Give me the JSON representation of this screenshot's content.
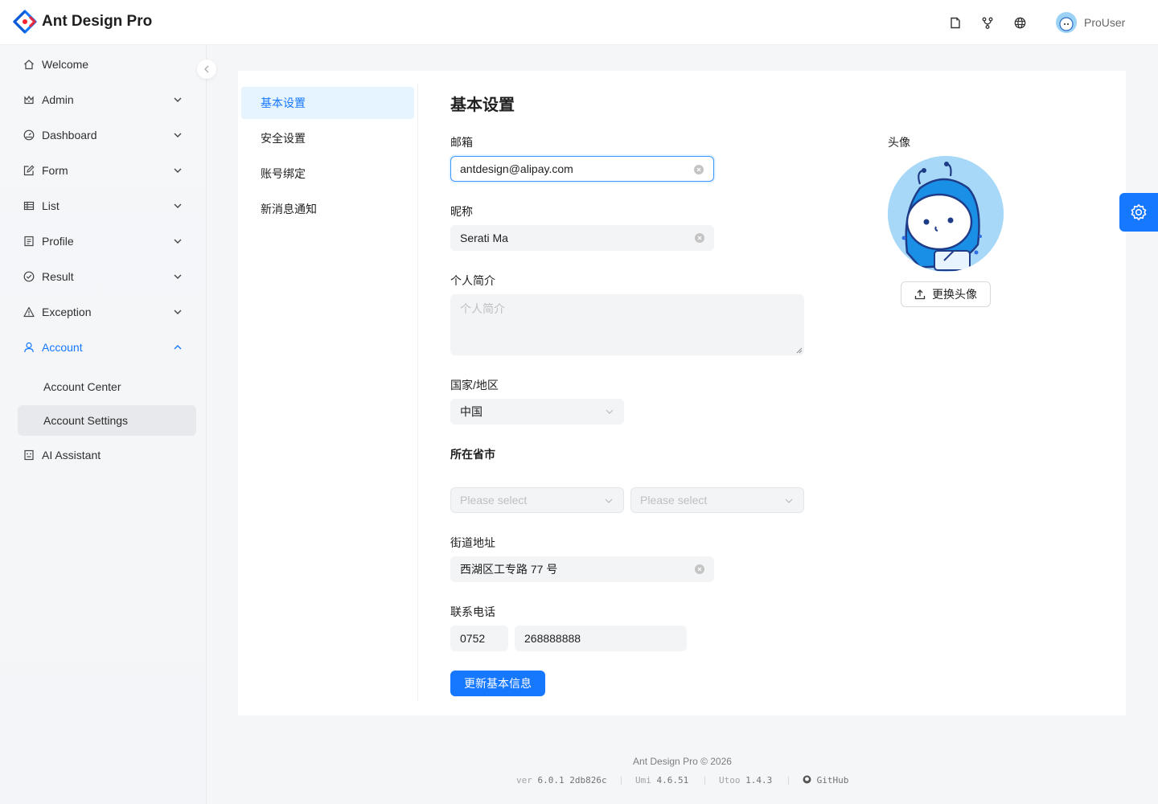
{
  "header": {
    "app_title": "Ant Design Pro",
    "user_name": "ProUser",
    "icons": [
      "docs-icon",
      "branch-icon",
      "language-icon"
    ]
  },
  "sidebar": {
    "items": [
      {
        "label": "Welcome",
        "icon": "home-icon"
      },
      {
        "label": "Admin",
        "icon": "crown-icon"
      },
      {
        "label": "Dashboard",
        "icon": "dashboard-icon"
      },
      {
        "label": "Form",
        "icon": "form-icon"
      },
      {
        "label": "List",
        "icon": "table-icon"
      },
      {
        "label": "Profile",
        "icon": "profile-icon"
      },
      {
        "label": "Result",
        "icon": "check-circle-icon"
      },
      {
        "label": "Exception",
        "icon": "warning-icon"
      },
      {
        "label": "Account",
        "icon": "user-icon"
      },
      {
        "label": "AI Assistant",
        "icon": "robot-icon"
      }
    ],
    "account_sub": [
      "Account Center",
      "Account Settings"
    ]
  },
  "settings_menu": [
    "基本设置",
    "安全设置",
    "账号绑定",
    "新消息通知"
  ],
  "form": {
    "title": "基本设置",
    "email_label": "邮箱",
    "email_value": "antdesign@alipay.com",
    "nickname_label": "昵称",
    "nickname_value": "Serati Ma",
    "bio_label": "个人简介",
    "bio_placeholder": "个人简介",
    "country_label": "国家/地区",
    "country_value": "中国",
    "province_label": "所在省市",
    "province_placeholder": "Please select",
    "city_placeholder": "Please select",
    "street_label": "街道地址",
    "street_value": "西湖区工专路 77 号",
    "phone_label": "联系电话",
    "phone_area": "0752",
    "phone_number": "268888888",
    "submit_label": "更新基本信息"
  },
  "avatar": {
    "label": "头像",
    "upload_label": "更换头像"
  },
  "footer": {
    "copyright": "Ant Design Pro © 2026",
    "ver_key": "ver",
    "ver_value": "6.0.1 2db826c",
    "umi_key": "Umi",
    "umi_value": "4.6.51",
    "utoo_key": "Utoo",
    "utoo_value": "1.4.3",
    "github": "GitHub"
  },
  "colors": {
    "primary": "#1677ff",
    "selected_bg": "#e6f4ff"
  }
}
